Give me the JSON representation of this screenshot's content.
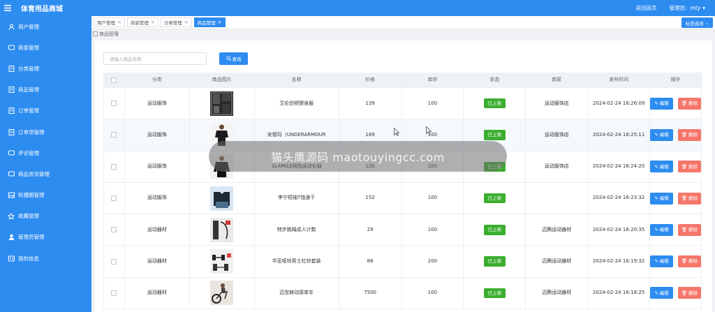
{
  "header": {
    "app_title": "体育用品商城",
    "home_link": "返回首页",
    "user_label": "管理员：mty"
  },
  "sidebar": {
    "items": [
      {
        "label": "用户管理",
        "icon": "user-icon"
      },
      {
        "label": "商家管理",
        "icon": "chat-icon"
      },
      {
        "label": "分类管理",
        "icon": "document-icon"
      },
      {
        "label": "商品管理",
        "icon": "document-icon"
      },
      {
        "label": "订单管理",
        "icon": "document-icon"
      },
      {
        "label": "订单项管理",
        "icon": "document-icon"
      },
      {
        "label": "评论管理",
        "icon": "chat-icon"
      },
      {
        "label": "商品资讯管理",
        "icon": "chat-icon"
      },
      {
        "label": "轮播图管理",
        "icon": "image-icon"
      },
      {
        "label": "收藏管理",
        "icon": "star-icon"
      },
      {
        "label": "管理员管理",
        "icon": "admin-user-icon"
      },
      {
        "label": "我的信息",
        "icon": "profile-card-icon"
      }
    ]
  },
  "tabs": [
    {
      "label": "用户管理",
      "active": false
    },
    {
      "label": "商家管理",
      "active": false
    },
    {
      "label": "分类管理",
      "active": false
    },
    {
      "label": "商品管理",
      "active": true
    }
  ],
  "tab_options_label": "标签选项",
  "breadcrumb": "商品管理",
  "search": {
    "placeholder": "请输入商品名称",
    "button_label": "查询"
  },
  "table": {
    "headers": [
      "分类",
      "商品图片",
      "名称",
      "价格",
      "库存",
      "状态",
      "商家",
      "发布时间",
      "操作"
    ],
    "status_label": "已上架",
    "edit_label": "编辑",
    "delete_label": "删除",
    "rows": [
      {
        "category": "运动服饰",
        "image": "dark-sportswear",
        "name": "艾伦伯顿健身服",
        "price": "139",
        "stock": "100",
        "merchant": "运动服饰店",
        "time": "2024-02-24 16:26:09"
      },
      {
        "category": "运动服饰",
        "image": "black-tshirt-man",
        "name": "安德玛（UNDERARMOUR",
        "price": "189",
        "stock": "100",
        "merchant": "运动服饰店",
        "time": "2024-02-24 16:25:11"
      },
      {
        "category": "运动服饰",
        "image": "long-sleeve-man",
        "name": "SLAMILE纯色运动长袖",
        "price": "120",
        "stock": "100",
        "merchant": "运动服饰店",
        "time": "2024-02-24 16:24:20"
      },
      {
        "category": "运动服饰",
        "image": "tshirt-pack",
        "name": "李宁短袖T恤速干",
        "price": "152",
        "stock": "100",
        "merchant": "",
        "time": "2024-02-24 16:23:32"
      },
      {
        "category": "运动器材",
        "image": "jump-rope-set",
        "name": "特步跳绳成人计数",
        "price": "29",
        "stock": "100",
        "merchant": "迈腾运动器材",
        "time": "2024-02-24 16:20:35"
      },
      {
        "category": "运动器材",
        "image": "dumbbell-set",
        "name": "华亚哑铃男士杠铃套装",
        "price": "88",
        "stock": "200",
        "merchant": "迈腾运动器材",
        "time": "2024-02-24 16:19:32"
      },
      {
        "category": "运动器材",
        "image": "exercise-bike",
        "name": "迈宝赫动感单车",
        "price": "7500",
        "stock": "100",
        "merchant": "迈腾运动器材",
        "time": "2024-02-24 16:18:25"
      }
    ]
  },
  "watermark_banner": "猫头鹰源码 maotouyingcc.com"
}
